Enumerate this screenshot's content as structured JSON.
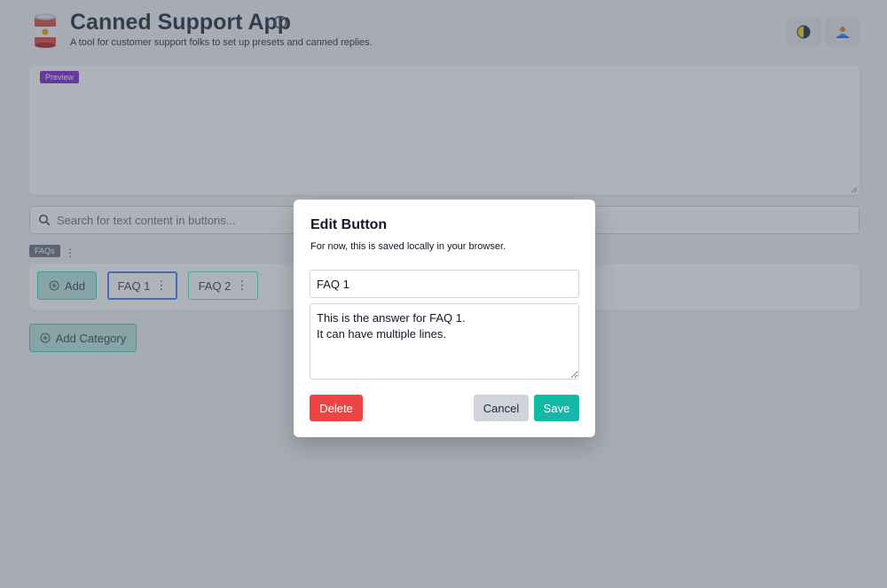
{
  "header": {
    "title": "Canned Support App",
    "subtitle": "A tool for customer support folks to set up presets and canned replies.",
    "logo_icon": "soup-can-icon",
    "info_icon": "info-circle-icon",
    "theme_icon": "contrast-icon",
    "user_icon": "user-icon"
  },
  "preview": {
    "badge": "Preview"
  },
  "search": {
    "placeholder": "Search for text content in buttons..."
  },
  "category": {
    "name": "FAQs",
    "menu_glyph": "⋮",
    "add_label": "Add",
    "buttons": [
      {
        "label": "FAQ 1",
        "menu_glyph": "⋮"
      },
      {
        "label": "FAQ 2",
        "menu_glyph": "⋮"
      }
    ]
  },
  "add_category_label": "Add Category",
  "modal": {
    "title": "Edit Button",
    "description": "For now, this is saved locally in your browser.",
    "label_value": "FAQ 1",
    "answer_value": "This is the answer for FAQ 1.\nIt can have multiple lines.",
    "delete_label": "Delete",
    "cancel_label": "Cancel",
    "save_label": "Save"
  },
  "colors": {
    "accent": "#14b8a6",
    "danger": "#ef4444",
    "preview_badge": "#7e22ce",
    "selected_border": "#3b82f6"
  }
}
